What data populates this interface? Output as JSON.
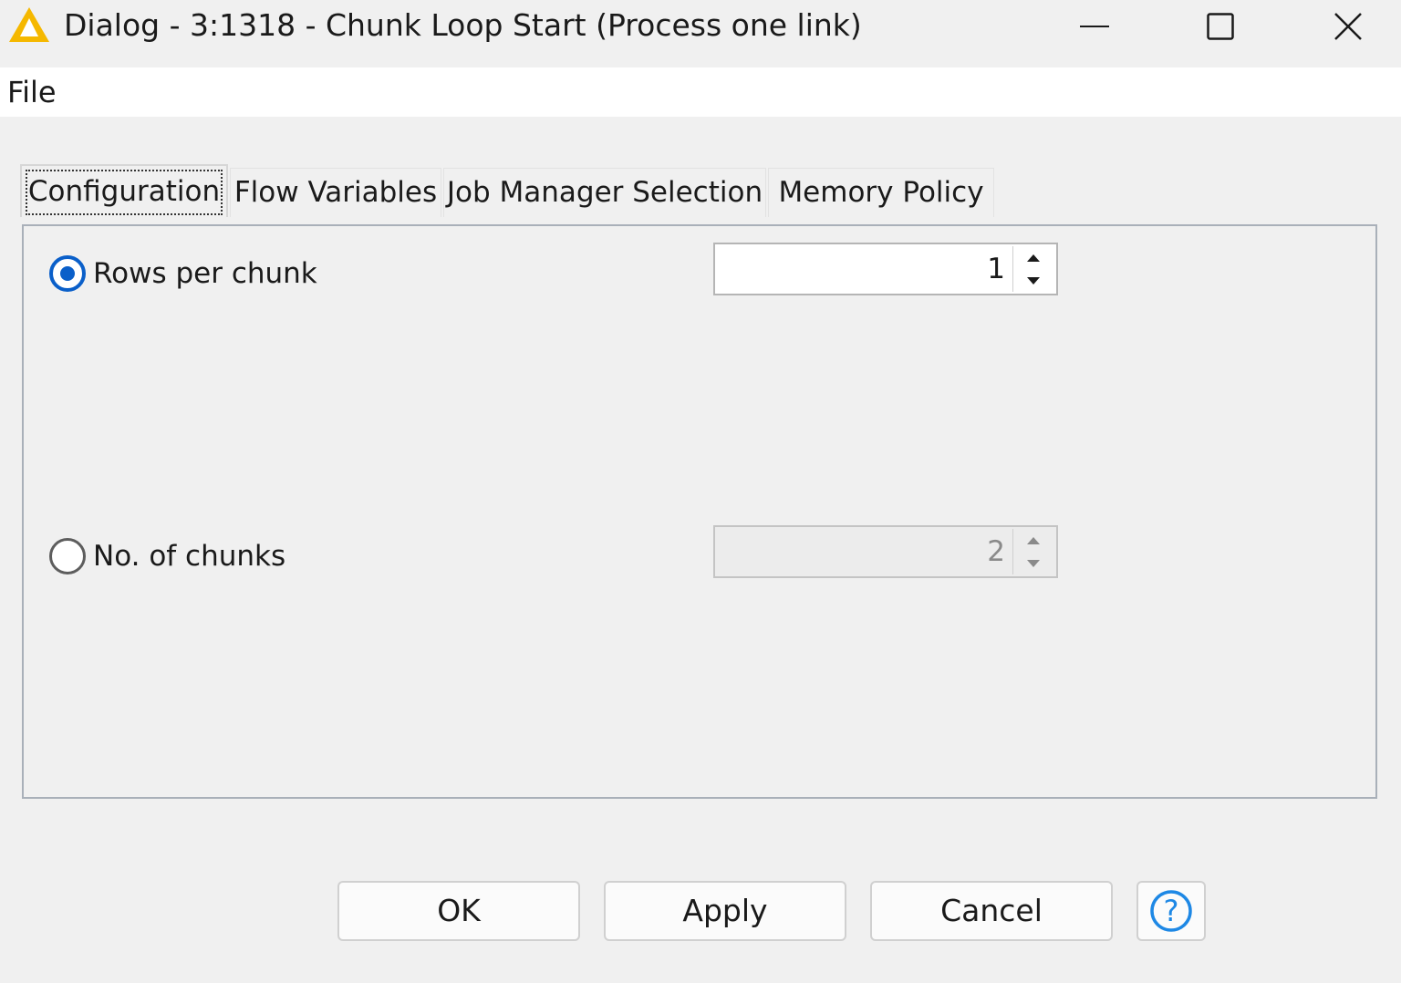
{
  "window": {
    "title": "Dialog - 3:1318 - Chunk Loop Start (Process one link)",
    "icon": "knime-warning-triangle-icon",
    "controls": [
      "minimize-icon",
      "maximize-icon",
      "close-icon"
    ]
  },
  "menubar": {
    "items": [
      {
        "label": "File"
      }
    ]
  },
  "tabs": [
    {
      "label": "Configuration",
      "selected": true
    },
    {
      "label": "Flow Variables",
      "selected": false
    },
    {
      "label": "Job Manager Selection",
      "selected": false
    },
    {
      "label": "Memory Policy",
      "selected": false
    }
  ],
  "config": {
    "options": [
      {
        "label": "Rows per chunk",
        "selected": true,
        "value": "1",
        "enabled": true
      },
      {
        "label": "No. of chunks",
        "selected": false,
        "value": "2",
        "enabled": false
      }
    ]
  },
  "buttons": {
    "ok": "OK",
    "apply": "Apply",
    "cancel": "Cancel",
    "help_icon": "help-icon"
  },
  "colors": {
    "accent": "#0a5fc9",
    "icon_warning": "#f5b800",
    "help": "#1e88e5"
  }
}
